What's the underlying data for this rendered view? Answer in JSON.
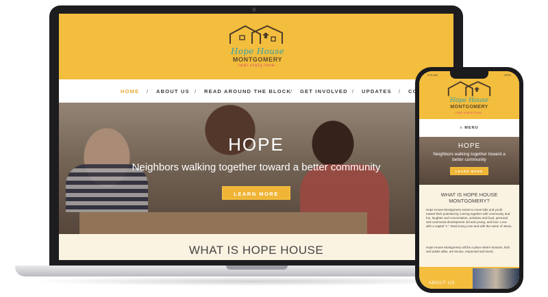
{
  "site": {
    "logo": {
      "line1": "Hope House",
      "line2": "MONTGOMERY",
      "line3": "real.crazy.love."
    },
    "nav": [
      "HOME",
      "ABOUT US",
      "READ AROUND THE BLOCK",
      "GET INVOLVED",
      "UPDATES",
      "CO"
    ],
    "nav_separator": "/",
    "hero": {
      "title": "HOPE",
      "subtitle": "Neighbors walking together toward a better community",
      "button": "LEARN MORE"
    },
    "section_title": "WHAT IS HOPE HOUSE"
  },
  "phone": {
    "time": "9:41 AM",
    "status": "100%",
    "menu_label": "≡ MENU",
    "hero": {
      "title": "HOPE",
      "subtitle": "Neighbors walking together toward a better community",
      "button": "LEARN MORE"
    },
    "section_title": "WHAT IS HOPE HOUSE MONTGOMERY?",
    "paragraph1": "Hope House Montgomery exists to move kids and youth toward their potential by coming together with community and fun, laughter and conversation, activities and food, personal and communal development old and young, and love. Love with a capital \"L\": Real.Crazy.Love and with the name of Jesus.",
    "paragraph2": "Hope House Montgomery will be a place where humans, kids and adults alike, are known, respected and loved.",
    "about_label": "ABOUT US"
  },
  "colors": {
    "brand_yellow": "#f3bd3d",
    "logo_teal": "#33a2a8",
    "logo_pink": "#d7446b",
    "active_nav": "#e8a72c",
    "cream": "#fbf3e2"
  }
}
